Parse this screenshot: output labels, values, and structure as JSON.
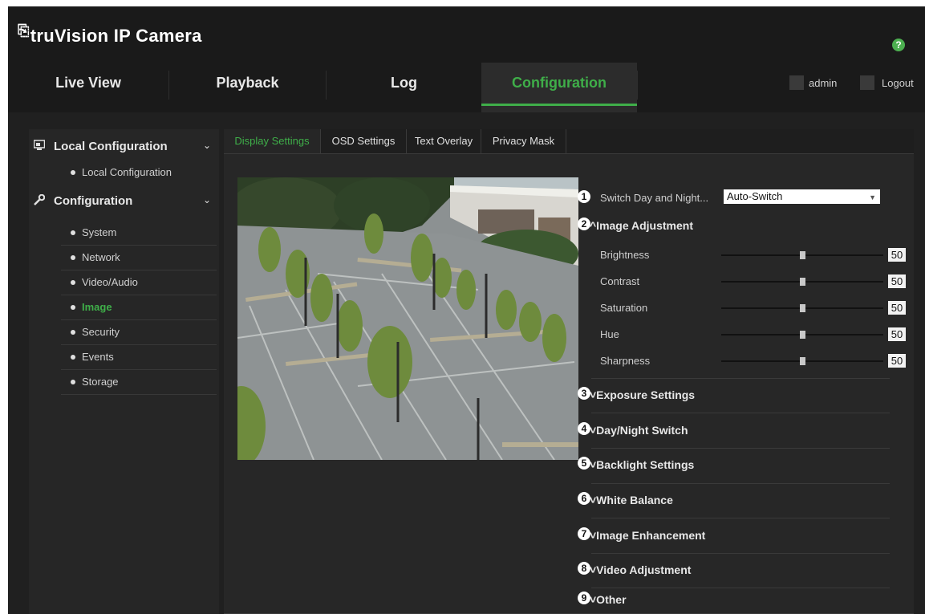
{
  "app": {
    "title_mark": "⎘",
    "title": "truVision IP Camera",
    "help_icon": "?"
  },
  "nav": {
    "tabs": [
      {
        "label": "Live View"
      },
      {
        "label": "Playback"
      },
      {
        "label": "Log"
      },
      {
        "label": "Configuration",
        "active": true
      }
    ],
    "user": "admin",
    "logout": "Logout"
  },
  "sidebar": {
    "groups": [
      {
        "label": "Local Configuration",
        "icon": "monitor-icon",
        "items": [
          {
            "label": "Local Configuration"
          }
        ]
      },
      {
        "label": "Configuration",
        "icon": "wrench-icon",
        "items": [
          {
            "label": "System"
          },
          {
            "label": "Network"
          },
          {
            "label": "Video/Audio"
          },
          {
            "label": "Image",
            "active": true
          },
          {
            "label": "Security"
          },
          {
            "label": "Events"
          },
          {
            "label": "Storage"
          }
        ]
      }
    ],
    "chevron": "⌄"
  },
  "subtabs": [
    {
      "label": "Display Settings",
      "active": true
    },
    {
      "label": "OSD Settings"
    },
    {
      "label": "Text Overlay"
    },
    {
      "label": "Privacy Mask"
    }
  ],
  "settings": {
    "switch_day_night": {
      "number": "1",
      "label": "Switch Day and Night...",
      "value": "Auto-Switch"
    },
    "image_adjustment": {
      "number": "2",
      "title": "^Image Adjustment",
      "sliders": [
        {
          "label": "Brightness",
          "value": "50",
          "fraction": 0.5
        },
        {
          "label": "Contrast",
          "value": "50",
          "fraction": 0.5
        },
        {
          "label": "Saturation",
          "value": "50",
          "fraction": 0.5
        },
        {
          "label": "Hue",
          "value": "50",
          "fraction": 0.5
        },
        {
          "label": "Sharpness",
          "value": "50",
          "fraction": 0.5
        }
      ]
    },
    "sections": [
      {
        "number": "3",
        "title": "˅Exposure Settings"
      },
      {
        "number": "4",
        "title": "˅Day/Night Switch"
      },
      {
        "number": "5",
        "title": "˅Backlight Settings"
      },
      {
        "number": "6",
        "title": "˅White Balance"
      },
      {
        "number": "7",
        "title": "˅Image Enhancement"
      },
      {
        "number": "8",
        "title": "˅Video Adjustment"
      },
      {
        "number": "9",
        "title": "˅Other",
        "plain": true
      }
    ]
  },
  "colors": {
    "accent": "#3fae49",
    "background": "#202020"
  }
}
